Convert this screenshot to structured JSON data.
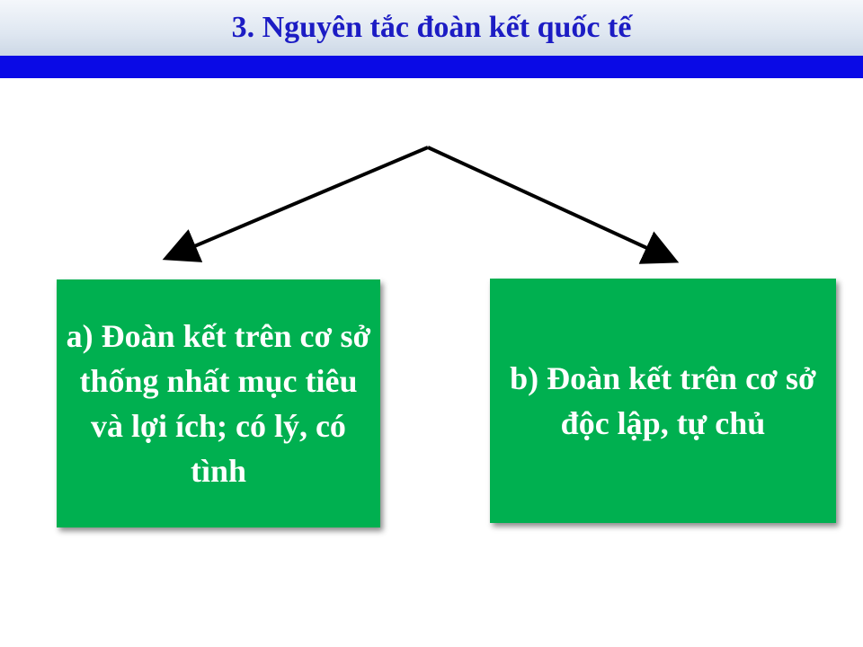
{
  "header": {
    "title": "3. Nguyên tắc đoàn kết quốc tế"
  },
  "boxes": {
    "left": "a) Đoàn kết trên cơ sở thống nhất mục tiêu và lợi ích; có lý, có tình",
    "right": "b) Đoàn kết trên cơ sở độc lập, tự chủ"
  },
  "colors": {
    "title_text": "#1c1cc4",
    "header_bar": "#0a0ae6",
    "box_fill": "#00b050",
    "box_text": "#ffffff",
    "arrow": "#000000"
  }
}
